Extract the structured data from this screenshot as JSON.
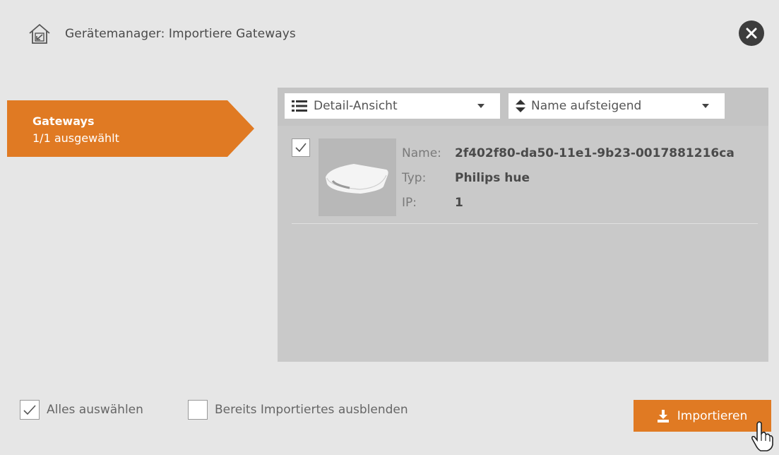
{
  "header": {
    "title": "Gerätemanager: Importiere Gateways",
    "icon": "home-import-icon"
  },
  "close_icon": "close-icon",
  "sidebar": {
    "tab_title": "Gateways",
    "tab_subtitle": "1/1 ausgewählt"
  },
  "toolbar": {
    "view_label": "Detail-Ansicht",
    "sort_label": "Name aufsteigend"
  },
  "items": [
    {
      "checked": true,
      "name_label": "Name:",
      "name_value": "2f402f80-da50-11e1-9b23-0017881216ca",
      "type_label": "Typ:",
      "type_value": "Philips hue",
      "ip_label": "IP:",
      "ip_value": "1"
    }
  ],
  "footer": {
    "select_all_label": "Alles auswählen",
    "select_all_checked": true,
    "hide_imported_label": "Bereits Importiertes ausblenden",
    "hide_imported_checked": false,
    "import_label": "Importieren"
  },
  "colors": {
    "accent": "#e07a23",
    "panel": "#c9c9c9",
    "background": "#e6e6e6"
  }
}
